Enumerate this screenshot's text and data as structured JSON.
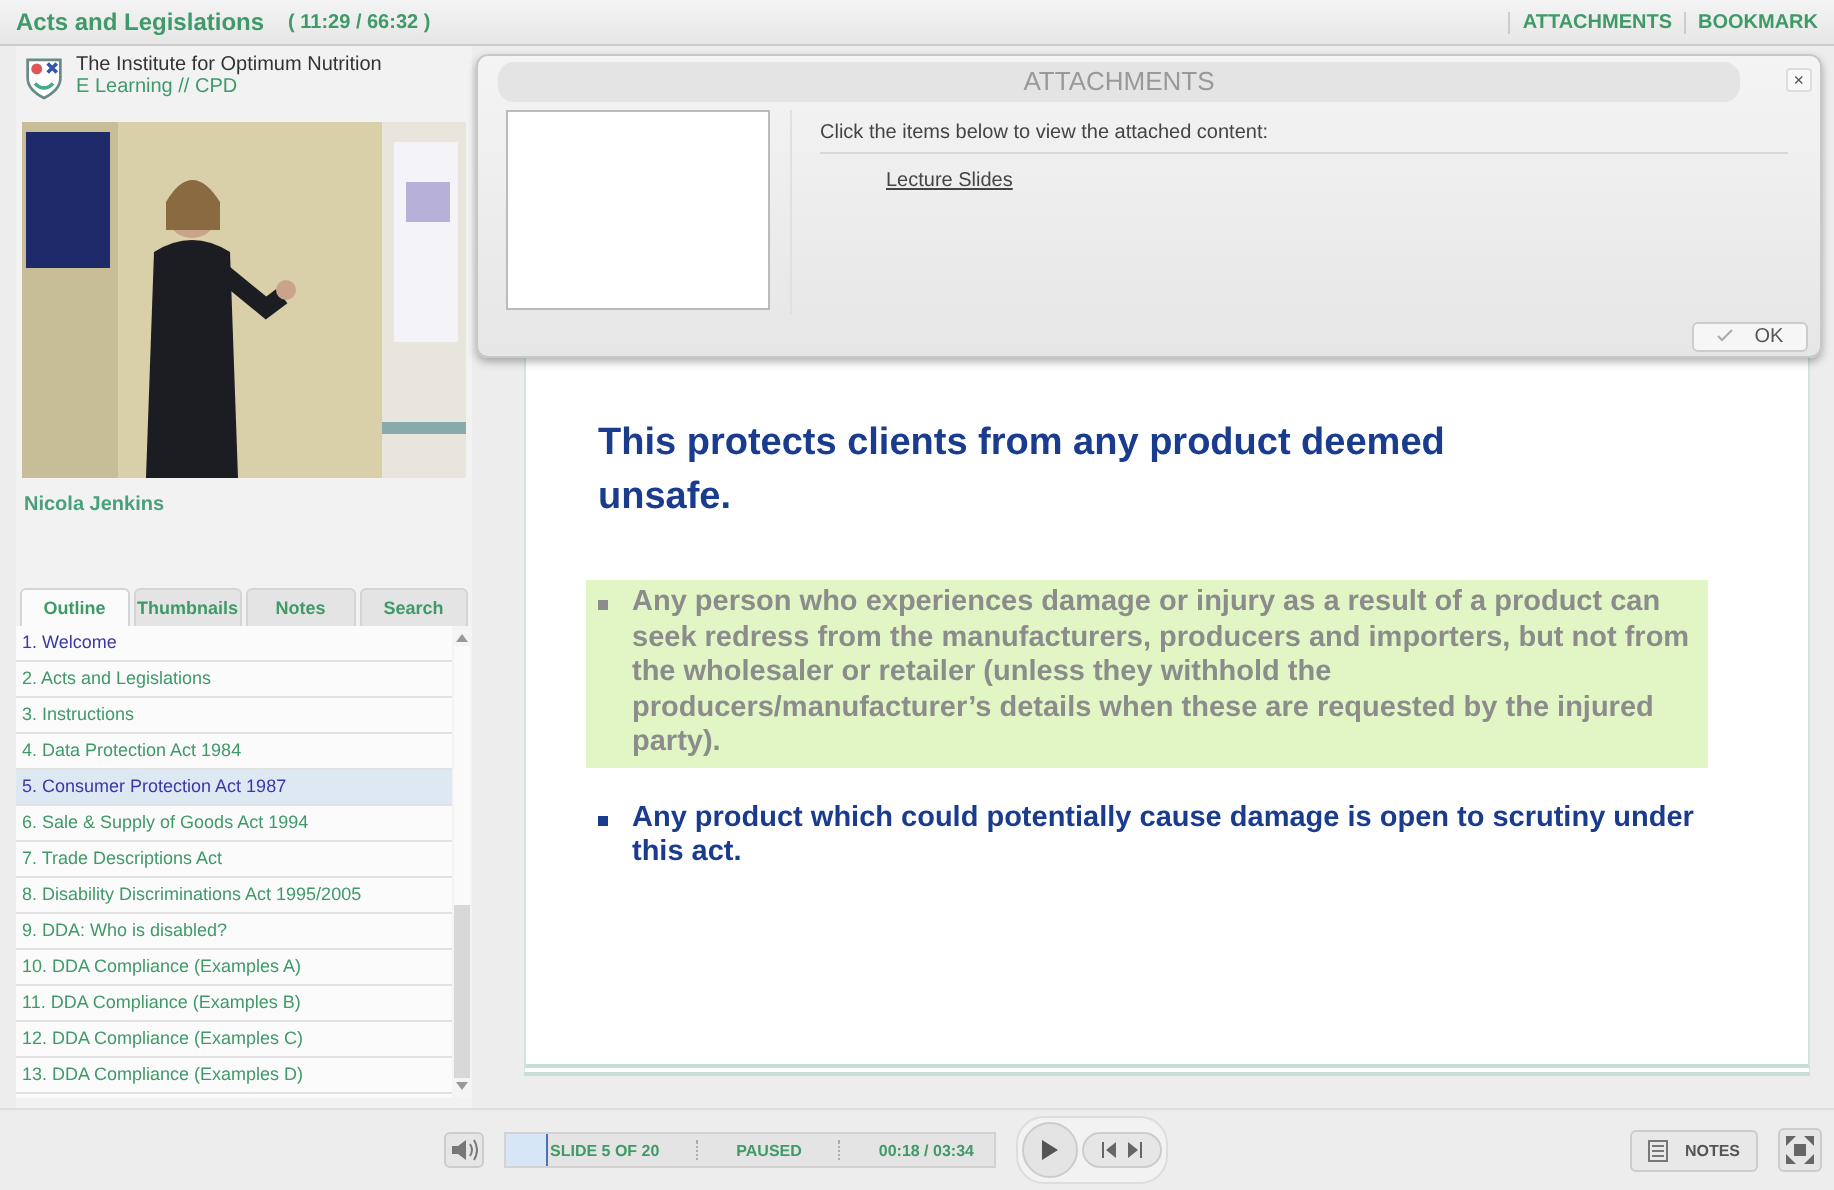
{
  "header": {
    "title": "Acts and Legislations",
    "time": "( 11:29 / 66:32 )",
    "links": [
      "ATTACHMENTS",
      "BOOKMARK"
    ]
  },
  "sidebar": {
    "org": "The Institute for Optimum Nutrition",
    "subtitle": "E Learning // CPD",
    "presenter": "Nicola Jenkins",
    "tabs": [
      {
        "label": "Outline",
        "selected": true
      },
      {
        "label": "Thumbnails",
        "selected": false
      },
      {
        "label": "Notes",
        "selected": false
      },
      {
        "label": "Search",
        "selected": false
      }
    ],
    "outline": [
      {
        "label": "1. Welcome",
        "selected": false,
        "visited": true
      },
      {
        "label": "2. Acts and Legislations",
        "selected": false,
        "visited": false
      },
      {
        "label": "3. Instructions",
        "selected": false,
        "visited": false
      },
      {
        "label": "4. Data Protection Act 1984",
        "selected": false,
        "visited": false
      },
      {
        "label": "5. Consumer Protection Act 1987",
        "selected": true,
        "visited": true
      },
      {
        "label": "6. Sale & Supply of Goods Act 1994",
        "selected": false,
        "visited": false
      },
      {
        "label": "7. Trade Descriptions Act",
        "selected": false,
        "visited": false
      },
      {
        "label": "8. Disability Discriminations Act 1995/2005",
        "selected": false,
        "visited": false
      },
      {
        "label": "9. DDA: Who is disabled?",
        "selected": false,
        "visited": false
      },
      {
        "label": "10. DDA Compliance (Examples A)",
        "selected": false,
        "visited": false
      },
      {
        "label": "11. DDA Compliance (Examples B)",
        "selected": false,
        "visited": false
      },
      {
        "label": "12. DDA Compliance (Examples C)",
        "selected": false,
        "visited": false
      },
      {
        "label": "13. DDA Compliance (Examples D)",
        "selected": false,
        "visited": false
      }
    ]
  },
  "attachments": {
    "title": "ATTACHMENTS",
    "close": "×",
    "instruction": "Click the items below to view the attached content:",
    "items": [
      "Lecture Slides"
    ],
    "ok": "OK"
  },
  "slide": {
    "subtitle": "This protects clients from any product deemed unsafe.",
    "bullets": [
      {
        "text": "Any person who experiences damage or injury as a result of a product can seek redress from the manufacturers, producers and importers, but not from the wholesaler or retailer (unless they withhold the producers/manufacturer’s details when these are requested by the injured party).",
        "highlighted": true
      },
      {
        "text": "Any product which could potentially cause damage is open to scrutiny under this act.",
        "highlighted": false
      }
    ]
  },
  "player": {
    "slide": "SLIDE 5 OF 20",
    "status": "PAUSED",
    "time": "00:18 / 03:34",
    "level": 0.08,
    "notes": "NOTES"
  }
}
